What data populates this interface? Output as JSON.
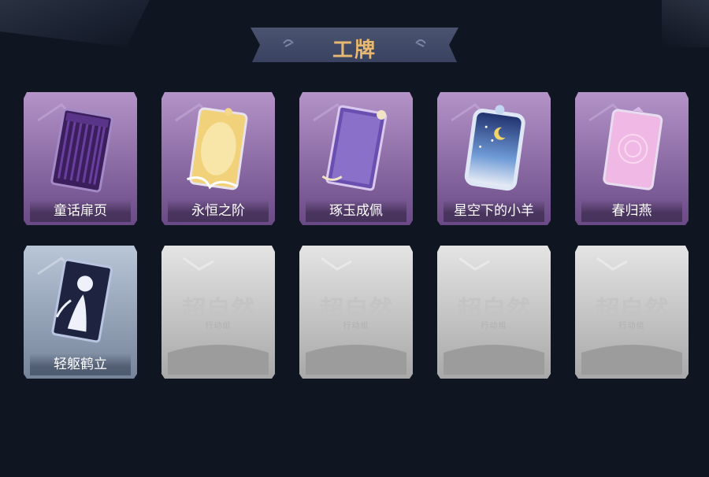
{
  "page": {
    "title": "工牌"
  },
  "colors": {
    "background": "#0f1521",
    "title": "#e9b870",
    "unlocked_frame": "#9a76b2",
    "frost_frame": "#a8b6c8",
    "locked_frame": "#b8b8b8"
  },
  "cards": [
    {
      "label": "童话扉页",
      "state": "unlocked",
      "art": "dark-purple-curtain-card"
    },
    {
      "label": "永恒之阶",
      "state": "unlocked",
      "art": "golden-feather-card"
    },
    {
      "label": "琢玉成佩",
      "state": "unlocked",
      "art": "violet-flower-card"
    },
    {
      "label": "星空下的小羊",
      "state": "unlocked",
      "art": "starry-sheep-card"
    },
    {
      "label": "春归燕",
      "state": "unlocked",
      "art": "pink-blossom-card"
    },
    {
      "label": "轻躯鹤立",
      "state": "unlocked",
      "art": "silhouette-card"
    },
    {
      "label": "",
      "state": "locked",
      "placeholder": "超自然",
      "sub": "行动组"
    },
    {
      "label": "",
      "state": "locked",
      "placeholder": "超自然",
      "sub": "行动组"
    },
    {
      "label": "",
      "state": "locked",
      "placeholder": "超自然",
      "sub": "行动组"
    },
    {
      "label": "",
      "state": "locked",
      "placeholder": "超自然",
      "sub": "行动组"
    }
  ]
}
